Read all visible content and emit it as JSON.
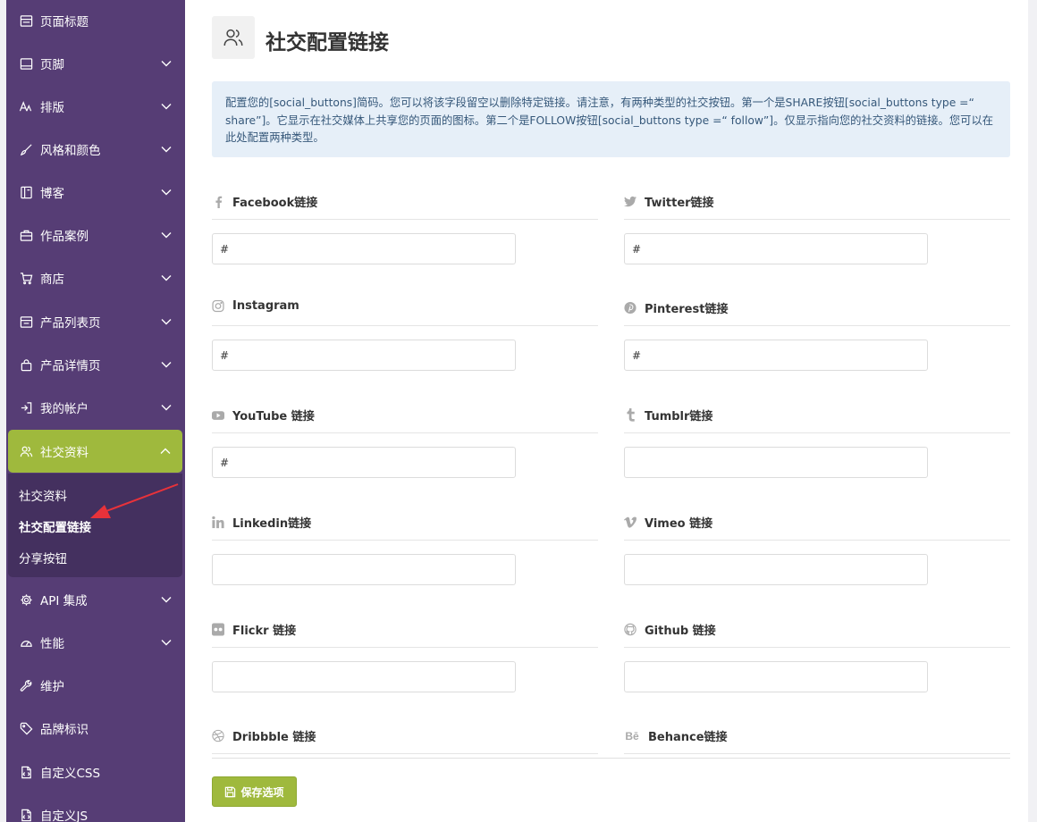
{
  "sidebar": {
    "items": [
      {
        "label": "页面标题",
        "icon": "page-title-icon",
        "chevron": false
      },
      {
        "label": "页脚",
        "icon": "footer-icon",
        "chevron": true
      },
      {
        "label": "排版",
        "icon": "typography-icon",
        "chevron": true
      },
      {
        "label": "风格和颜色",
        "icon": "brush-icon",
        "chevron": true
      },
      {
        "label": "博客",
        "icon": "blog-icon",
        "chevron": true
      },
      {
        "label": "作品案例",
        "icon": "portfolio-icon",
        "chevron": true
      },
      {
        "label": "商店",
        "icon": "cart-icon",
        "chevron": true
      },
      {
        "label": "产品列表页",
        "icon": "product-list-icon",
        "chevron": true
      },
      {
        "label": "产品详情页",
        "icon": "bag-icon",
        "chevron": true
      },
      {
        "label": "我的帐户",
        "icon": "login-icon",
        "chevron": true
      },
      {
        "label": "社交资料",
        "icon": "users-icon",
        "chevron": true,
        "active": true
      },
      {
        "label": "API 集成",
        "icon": "gear-icon",
        "chevron": true
      },
      {
        "label": "性能",
        "icon": "gauge-icon",
        "chevron": true
      },
      {
        "label": "维护",
        "icon": "wrench-icon",
        "chevron": false
      },
      {
        "label": "品牌标识",
        "icon": "tag-icon",
        "chevron": false
      },
      {
        "label": "自定义CSS",
        "icon": "css-file-icon",
        "chevron": false
      },
      {
        "label": "自定义JS",
        "icon": "js-file-icon",
        "chevron": false
      }
    ],
    "submenu": [
      {
        "label": "社交资料"
      },
      {
        "label": "社交配置链接",
        "current": true
      },
      {
        "label": "分享按钮"
      }
    ]
  },
  "header": {
    "title": "社交配置链接"
  },
  "notice": {
    "text": "配置您的[social_buttons]简码。您可以将该字段留空以删除特定链接。请注意，有两种类型的社交按钮。第一个是SHARE按钮[social_buttons type =“ share”]。它显示在社交媒体上共享您的页面的图标。第二个是FOLLOW按钮[social_buttons type =“ follow”]。仅显示指向您的社交资料的链接。您可以在此处配置两种类型。"
  },
  "fields": [
    {
      "label": "Facebook链接",
      "value": "#",
      "icon": "facebook-icon"
    },
    {
      "label": "Twitter链接",
      "value": "#",
      "icon": "twitter-icon"
    },
    {
      "label": "Instagram",
      "value": "#",
      "icon": "instagram-icon"
    },
    {
      "label": "Pinterest链接",
      "value": "#",
      "icon": "pinterest-icon"
    },
    {
      "label": "YouTube 链接",
      "value": "#",
      "icon": "youtube-icon"
    },
    {
      "label": "Tumblr链接",
      "value": "",
      "icon": "tumblr-icon"
    },
    {
      "label": "Linkedin链接",
      "value": "",
      "icon": "linkedin-icon"
    },
    {
      "label": "Vimeo 链接",
      "value": "",
      "icon": "vimeo-icon"
    },
    {
      "label": "Flickr 链接",
      "value": "",
      "icon": "flickr-icon"
    },
    {
      "label": "Github 链接",
      "value": "",
      "icon": "github-icon"
    },
    {
      "label": "Dribbble 链接",
      "value": "",
      "icon": "dribbble-icon"
    },
    {
      "label": "Behance链接",
      "value": "",
      "icon": "behance-icon"
    }
  ],
  "save_button": {
    "label": "保存选项",
    "icon": "save-icon"
  },
  "colors": {
    "sidebar_bg": "#563d75",
    "accent": "#9fb93d",
    "notice_bg": "#e6eff8",
    "notice_text": "#36587a",
    "annotation_arrow": "#e8323a"
  }
}
